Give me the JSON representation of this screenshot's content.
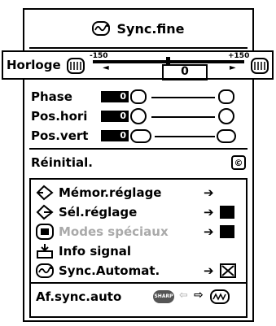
{
  "title": "Sync.fine",
  "horloge": {
    "label": "Horloge",
    "min_label": "-150",
    "max_label": "+150",
    "value": "0"
  },
  "adjust_rows": [
    {
      "label": "Phase",
      "value": "0"
    },
    {
      "label": "Pos.hori",
      "value": "0"
    },
    {
      "label": "Pos.vert",
      "value": "0"
    }
  ],
  "reset": {
    "label": "Réinitial."
  },
  "menu_items": [
    {
      "label": "Mémor.réglage",
      "disabled": false
    },
    {
      "label": "Sél.réglage",
      "disabled": false
    },
    {
      "label": "Modes spéciaux",
      "disabled": true
    },
    {
      "label": "Info signal",
      "disabled": false
    },
    {
      "label": "Sync.Automat.",
      "disabled": false
    },
    {
      "label": "Af.sync.auto",
      "disabled": false
    }
  ],
  "slider_signs": {
    "minus": "-",
    "plus": "+"
  },
  "arrow_glyph": "➔",
  "reset_glyph": "©",
  "auto_badge": "SHARP"
}
